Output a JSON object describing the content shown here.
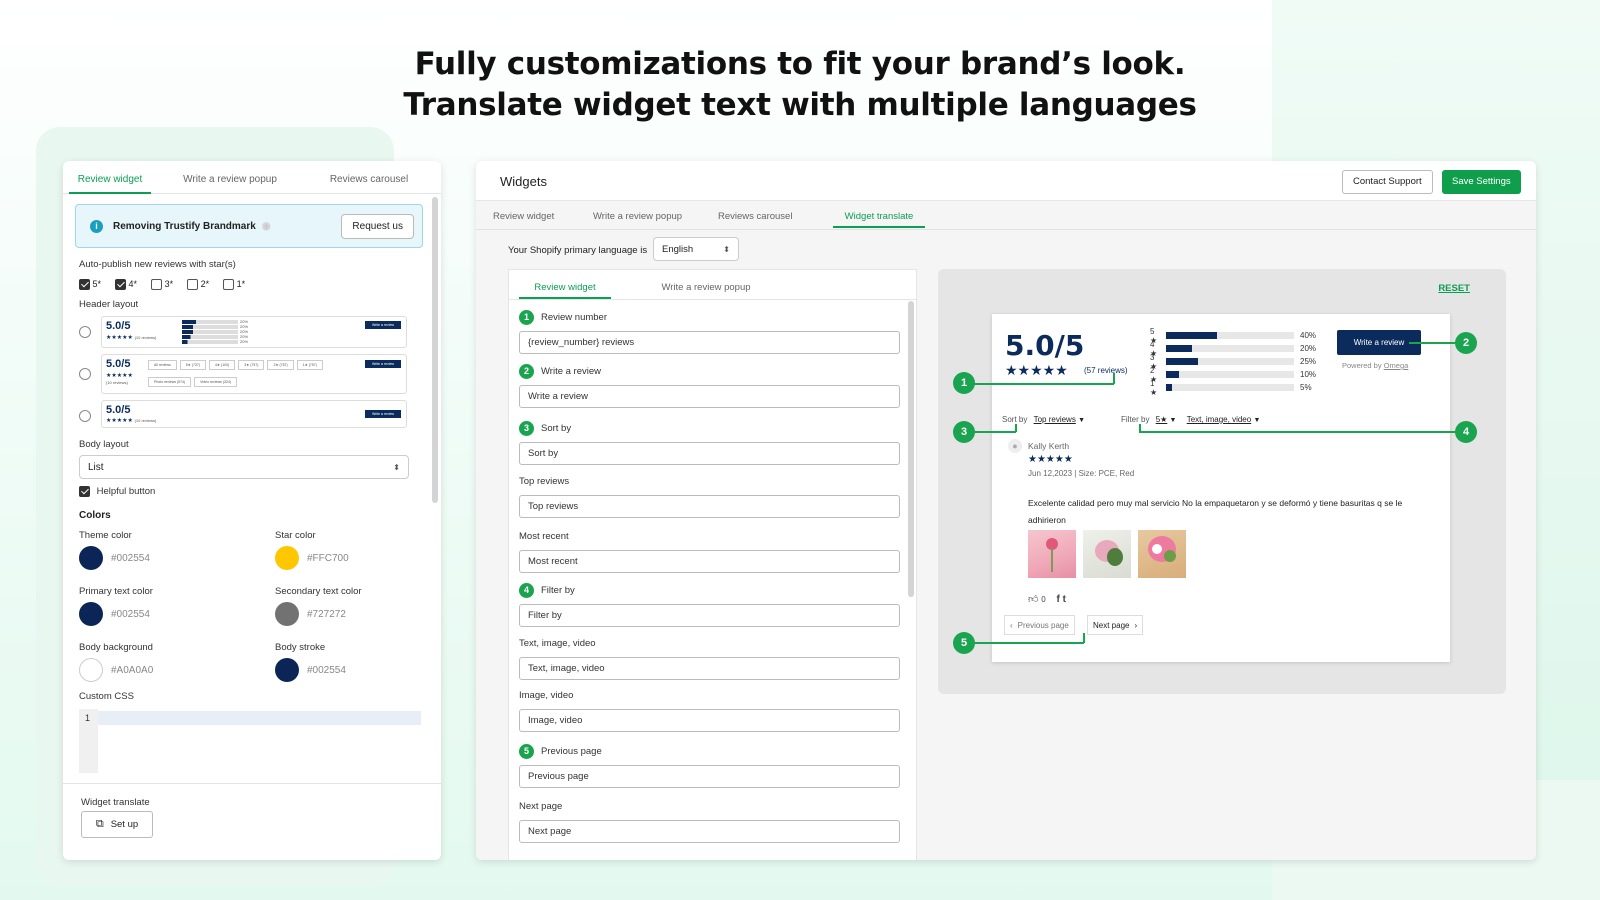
{
  "headline": {
    "line1": "Fully customizations to fit your brand’s look.",
    "line2": "Translate widget text with multiple languages"
  },
  "left_panel": {
    "tabs": [
      "Review widget",
      "Write a review popup",
      "Reviews carousel"
    ],
    "brandmark": {
      "text": "Removing Trustify Brandmark",
      "button": "Request us"
    },
    "auto_publish": {
      "label": "Auto-publish new reviews with star(s)",
      "options": [
        {
          "label": "5*",
          "checked": true
        },
        {
          "label": "4*",
          "checked": true
        },
        {
          "label": "3*",
          "checked": false
        },
        {
          "label": "2*",
          "checked": false
        },
        {
          "label": "1*",
          "checked": false
        }
      ]
    },
    "header_layout": {
      "label": "Header layout",
      "score": "5.0/5",
      "mini_stars": "★★★★★",
      "mini_count": "(10 reviews)",
      "mini_button": "Write a review",
      "chips": [
        "All reviews",
        "5★ (737)",
        "4★ (100)",
        "3★ (757)",
        "2★ (757)",
        "1★ (757)"
      ],
      "chips2": [
        "Photo reviews (574)",
        "Video reviews (324)"
      ],
      "mini_pcts": [
        "20%",
        "20%",
        "20%",
        "20%",
        "20%"
      ]
    },
    "body_layout": {
      "label": "Body layout",
      "value": "List"
    },
    "helpful_button": {
      "label": "Helpful button",
      "checked": true
    },
    "colors": {
      "title": "Colors",
      "items": [
        {
          "label": "Theme color",
          "hex": "#002554",
          "swatch": "#0a2556"
        },
        {
          "label": "Star color",
          "hex": "#FFC700",
          "swatch": "#ffc700"
        },
        {
          "label": "Primary text color",
          "hex": "#002554",
          "swatch": "#0a2556"
        },
        {
          "label": "Secondary text color",
          "hex": "#727272",
          "swatch": "#727272"
        },
        {
          "label": "Body background",
          "hex": "#A0A0A0",
          "swatch": "#ffffff"
        },
        {
          "label": "Body stroke",
          "hex": "#002554",
          "swatch": "#0a2556"
        }
      ]
    },
    "custom_css": {
      "label": "Custom CSS",
      "line": "1"
    },
    "widget_translate": {
      "label": "Widget translate",
      "button": "Set up"
    }
  },
  "main_panel": {
    "title": "Widgets",
    "contact_button": "Contact Support",
    "save_button": "Save Settings",
    "tabs": [
      "Review widget",
      "Write a review popup",
      "Reviews carousel",
      "Widget translate"
    ],
    "language": {
      "label": "Your Shopify primary language is",
      "value": "English"
    },
    "form_tabs": [
      "Review widget",
      "Write a review popup"
    ],
    "fields": [
      {
        "num": "1",
        "label": "Review number",
        "value": "{review_number} reviews"
      },
      {
        "num": "2",
        "label": "Write a review",
        "value": "Write a review"
      },
      {
        "num": "3",
        "label": "Sort by",
        "value": "Sort by"
      },
      {
        "num": "",
        "label": "Top reviews",
        "value": "Top reviews"
      },
      {
        "num": "",
        "label": "Most recent",
        "value": "Most recent"
      },
      {
        "num": "4",
        "label": "Filter by",
        "value": "Filter by"
      },
      {
        "num": "",
        "label": "Text, image, video",
        "value": "Text, image, video"
      },
      {
        "num": "",
        "label": "Image, video",
        "value": "Image, video"
      },
      {
        "num": "5",
        "label": "Previous page",
        "value": "Previous page"
      },
      {
        "num": "",
        "label": "Next page",
        "value": "Next page"
      }
    ],
    "preview": {
      "reset": "RESET",
      "score": "5.0/5",
      "stars": "★★★★★",
      "review_count": "(57 reviews)",
      "bars": [
        {
          "label": "5 ★",
          "pct": 40,
          "text": "40%"
        },
        {
          "label": "4 ★",
          "pct": 20,
          "text": "20%"
        },
        {
          "label": "3 ★",
          "pct": 25,
          "text": "25%"
        },
        {
          "label": "2 ★",
          "pct": 10,
          "text": "10%"
        },
        {
          "label": "1 ★",
          "pct": 5,
          "text": "5%"
        }
      ],
      "write_button": "Write a review",
      "powered_by": "Powered by",
      "powered_brand": "Omega",
      "sort_label": "Sort by",
      "sort_value": "Top reviews",
      "filter_label": "Filter by",
      "filter_star": "5★",
      "filter_value": "Text, image, video",
      "reviewer": "Kally Kerth",
      "review_stars": "★★★★★",
      "review_meta": "Jun 12,2023 | Size: PCE, Red",
      "review_text": "Excelente calidad pero muy mal servicio No la empaquetaron y se deformó y tiene basuritas q se le adhirieron",
      "helpful_count": "0",
      "prev_page": "Previous page",
      "next_page": "Next page",
      "callouts": [
        "1",
        "2",
        "3",
        "4",
        "5"
      ]
    }
  }
}
